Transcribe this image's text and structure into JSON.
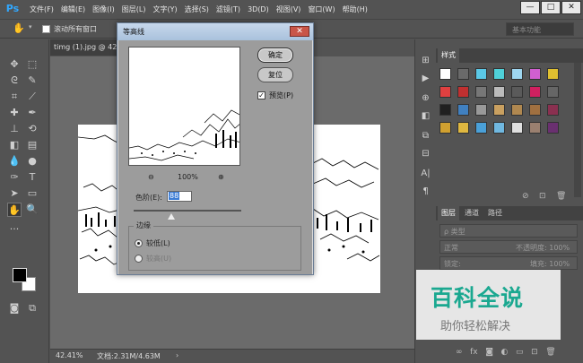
{
  "app": {
    "logo": "Ps"
  },
  "menu": {
    "items": [
      "文件(F)",
      "编辑(E)",
      "图像(I)",
      "图层(L)",
      "文字(Y)",
      "选择(S)",
      "滤镜(T)",
      "3D(D)",
      "视图(V)",
      "窗口(W)",
      "帮助(H)"
    ]
  },
  "window_controls": {
    "minimize": "—",
    "restore": "□",
    "close": "✕"
  },
  "options_bar": {
    "scroll_all_windows": "滚动所有窗口",
    "scroll_all_checked": false,
    "workspace": "基本功能"
  },
  "document": {
    "tab_title": "timg (1).jpg @ 42.4%",
    "zoom": "42.41%",
    "doc_info": "文档:2.31M/4.63M"
  },
  "panels": {
    "styles_tab": "样式",
    "layers_tabs": [
      "图层",
      "通道",
      "路径"
    ],
    "filter_kind": "ρ 类型",
    "blend_mode": "正常",
    "opacity": "不透明度: 100%",
    "lock_label": "锁定:",
    "fill": "填充: 100%"
  },
  "dialog": {
    "title": "等高线",
    "ok": "确定",
    "reset": "复位",
    "preview_label": "预览(P)",
    "preview_checked": true,
    "zoom_percent": "100%",
    "level_label": "色阶(E):",
    "level_value": "88",
    "level_fraction": 0.35,
    "edge_legend": "边缘",
    "lower_label": "较低(L)",
    "upper_label": "较高(U)",
    "edge_selected": "lower"
  },
  "watermark": {
    "logo": "百科全说",
    "slogan": "助你轻松解决"
  },
  "colors": {
    "accent_logo": "#31a8ff",
    "watermark_green": "#1aa890",
    "close_red": "#c95548"
  }
}
